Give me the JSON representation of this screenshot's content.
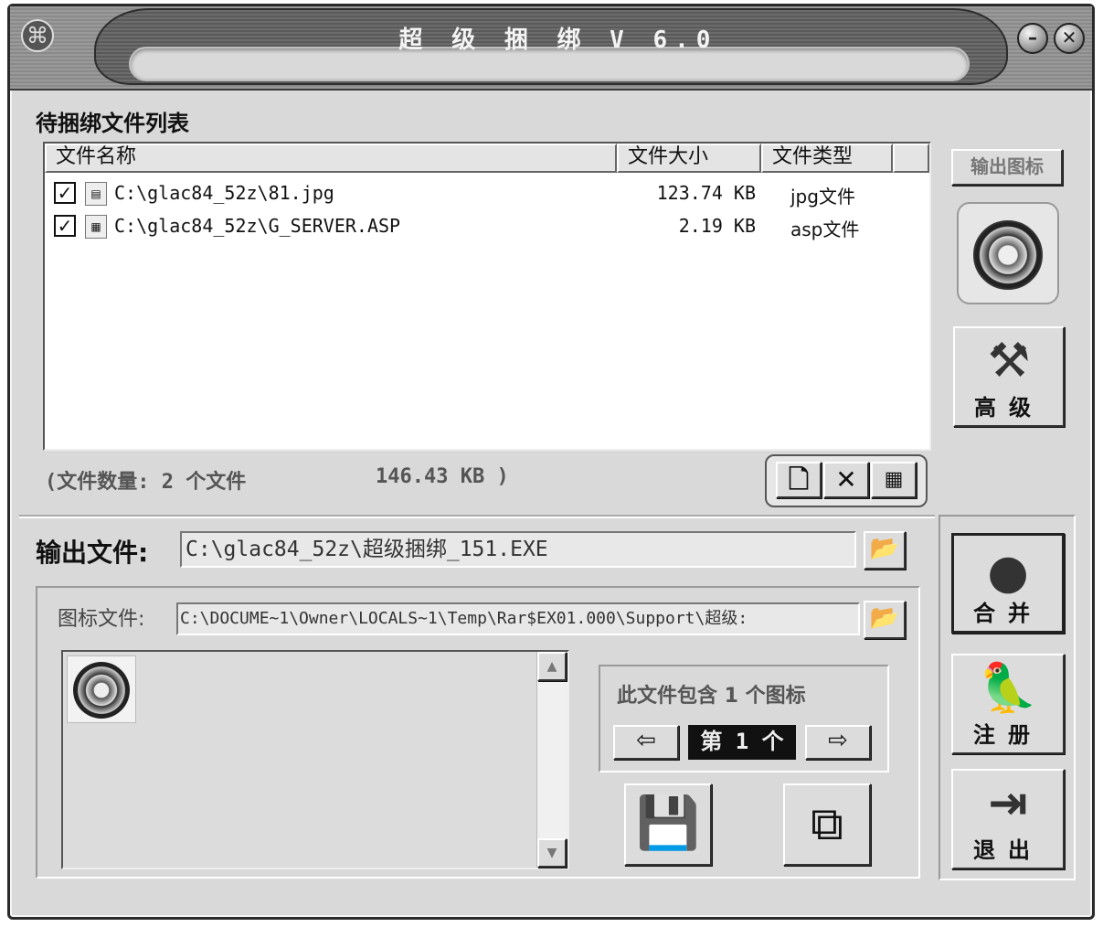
{
  "window": {
    "title": "超 级 捆 绑 V 6.0",
    "minimize": "–",
    "close": "✕"
  },
  "file_list": {
    "heading": "待捆绑文件列表",
    "columns": [
      "文件名称",
      "文件大小",
      "文件类型"
    ],
    "rows": [
      {
        "checked": true,
        "name": "C:\\glac84_52z\\81.jpg",
        "size": "123.74 KB",
        "type": "jpg文件"
      },
      {
        "checked": true,
        "name": "C:\\glac84_52z\\G_SERVER.ASP",
        "size": "2.19 KB",
        "type": "asp文件"
      }
    ],
    "summary_prefix": "(文件数量: 2 个文件",
    "summary_size": "146.43 KB )"
  },
  "right_panel": {
    "output_icon_label": "输出图标",
    "advanced_label": "高级",
    "merge_label": "合并",
    "register_label": "注册",
    "exit_label": "退出"
  },
  "output": {
    "label": "输出文件:",
    "path": "C:\\glac84_52z\\超级捆绑_151.EXE"
  },
  "icon_file": {
    "label": "图标文件:",
    "path": "C:\\DOCUME~1\\Owner\\LOCALS~1\\Temp\\Rar$EX01.000\\Support\\超级:"
  },
  "icon_info": {
    "contains_text": "此文件包含 1 个图标",
    "current": "第 1 个"
  },
  "icons": {
    "app": "knot-icon",
    "folder": "folder-open-icon",
    "new": "new-file-icon",
    "delete": "delete-icon",
    "clear": "clear-list-icon",
    "prev": "arrow-left-icon",
    "next": "arrow-right-icon",
    "save": "floppy-disk-icon",
    "extract": "copy-disks-icon"
  }
}
